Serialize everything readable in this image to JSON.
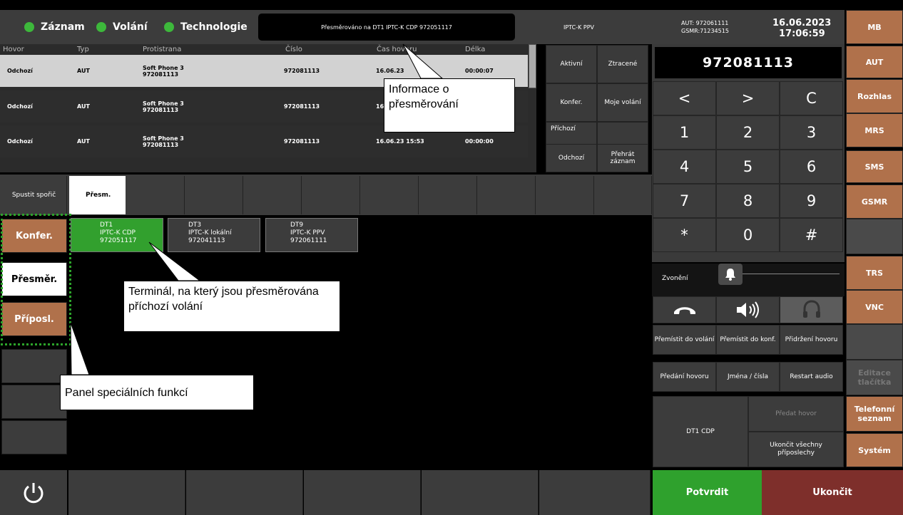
{
  "topbar": {
    "indicators": [
      {
        "label": "Záznam"
      },
      {
        "label": "Volání"
      },
      {
        "label": "Technologie"
      }
    ],
    "redirect_info": "Přesměrováno na DT1 IPTC-K CDP 972051117",
    "terminal_name": "IPTC-K PPV",
    "aut": "AUT: 972061111",
    "gsmr": "GSMR:71234515",
    "date": "16.06.2023",
    "time": "17:06:59"
  },
  "call_list": {
    "columns": [
      "Hovor",
      "Typ",
      "Protistrana",
      "Číslo",
      "Čas hovoru",
      "Délka"
    ],
    "rows": [
      {
        "direction": "Odchozí",
        "type": "AUT",
        "party": "Soft Phone 3",
        "party_number": "972081113",
        "number": "972081113",
        "time": "16.06.23",
        "duration": "00:00:07"
      },
      {
        "direction": "Odchozí",
        "type": "AUT",
        "party": "Soft Phone 3",
        "party_number": "972081113",
        "number": "972081113",
        "time": "16",
        "duration": ""
      },
      {
        "direction": "Odchozí",
        "type": "AUT",
        "party": "Soft Phone 3",
        "party_number": "972081113",
        "number": "972081113",
        "time": "16.06.23 15:53",
        "duration": "00:00:00"
      }
    ]
  },
  "filters": [
    {
      "label": "Aktivní"
    },
    {
      "label": "Ztracené"
    },
    {
      "label": "Konfer."
    },
    {
      "label": "Moje volání"
    },
    {
      "label": "Příchozí"
    },
    {
      "label": ""
    },
    {
      "label": "Odchozí"
    },
    {
      "label": "Přehrát záznam"
    }
  ],
  "keypad": {
    "display": "972081113",
    "keys": [
      "<",
      ">",
      "C",
      "1",
      "2",
      "3",
      "4",
      "5",
      "6",
      "7",
      "8",
      "9",
      "*",
      "0",
      "#"
    ],
    "ringer_label": "Zvonění",
    "functions": [
      {
        "label": "Přemístit do volání"
      },
      {
        "label": "Přemístit do konf."
      },
      {
        "label": "Přidržení hovoru"
      },
      {
        "label": "Předání hovoru"
      },
      {
        "label": "Jména / čísla"
      },
      {
        "label": "Restart audio"
      }
    ],
    "dt1_label": "DT1 CDP",
    "transfer_call": "Předat hovor",
    "end_all_listen": "Ukončit všechny příposlechy",
    "confirm": "Potvrdit",
    "end": "Ukončit"
  },
  "sidebar": [
    {
      "label": "MB"
    },
    {
      "label": "AUT"
    },
    {
      "label": "Rozhlas"
    },
    {
      "label": "MRS"
    },
    {
      "label": "SMS"
    },
    {
      "label": "GSMR"
    },
    {
      "label": ""
    },
    {
      "label": "TRS"
    },
    {
      "label": "VNC"
    },
    {
      "label": ""
    },
    {
      "label": "Editace tlačítka"
    },
    {
      "label": "Telefonní seznam"
    },
    {
      "label": "Systém"
    }
  ],
  "left_panel": {
    "screensaver": "Spustit spořič",
    "items": [
      {
        "label": "Konfer."
      },
      {
        "label": "Přesměr."
      },
      {
        "label": "Příposl."
      }
    ]
  },
  "tabs": {
    "active": "Přesm."
  },
  "terminals": [
    {
      "id": "DT1",
      "name": "IPTC-K CDP",
      "number": "972051117"
    },
    {
      "id": "DT3",
      "name": "IPTC-K lokální",
      "number": "972041113"
    },
    {
      "id": "DT9",
      "name": "IPTC-K PPV",
      "number": "972061111"
    }
  ],
  "annotations": {
    "redirect_info": "Informace o přesměrování",
    "terminal": "Terminál, na který jsou přesměrována příchozí volání",
    "panel": "Panel speciálních funkcí"
  },
  "colors": {
    "active_green": "#32a02e",
    "accent_brown": "#b0714b",
    "confirm_green": "#2fa12d",
    "end_red": "#7e2f2b"
  }
}
